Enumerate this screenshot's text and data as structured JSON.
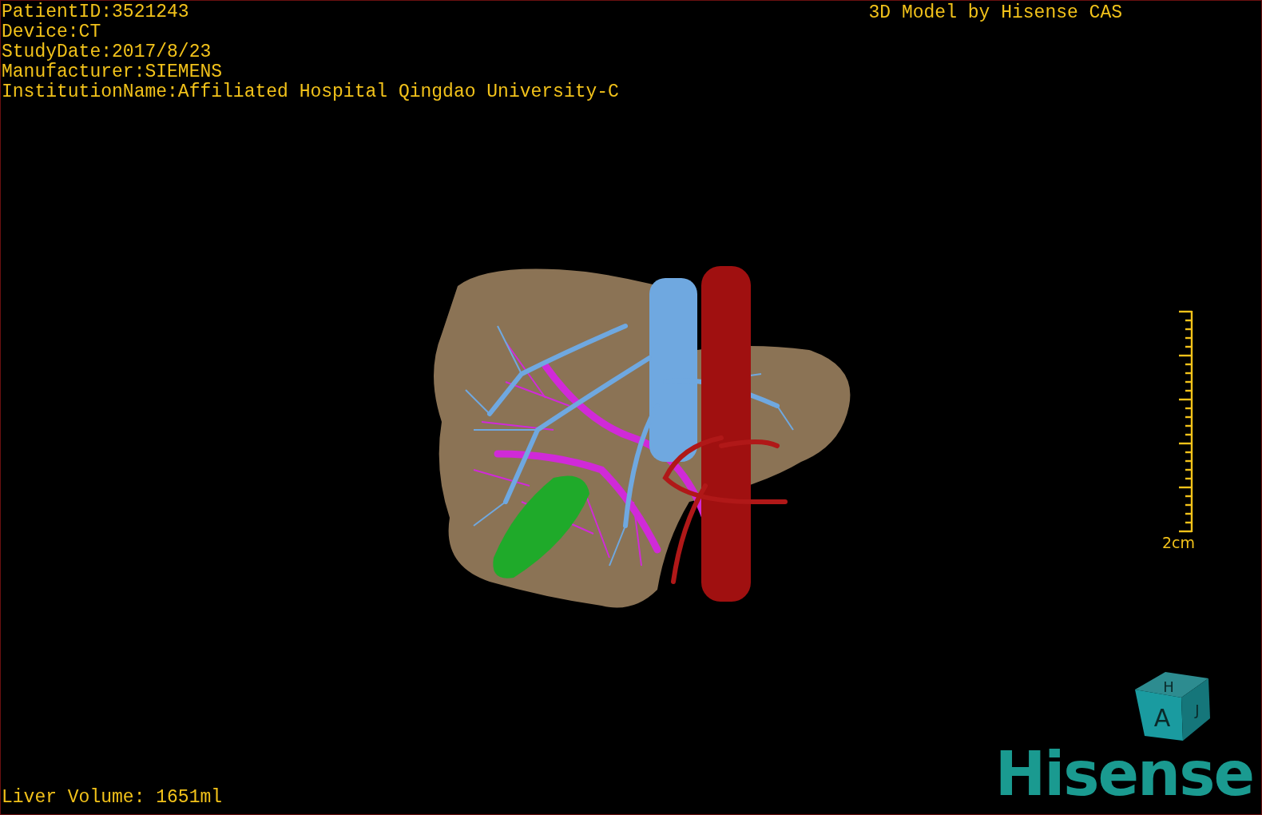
{
  "study_info": [
    "PatientID:3521243",
    "Device:CT",
    "StudyDate:2017/8/23",
    "Manufacturer:SIEMENS",
    "InstitutionName:Affiliated Hospital Qingdao University-C"
  ],
  "title": "3D Model by Hisense CAS",
  "scale_bar": {
    "label": "2cm"
  },
  "orientation_cube": {
    "top": "H",
    "front": "A",
    "side": "J"
  },
  "liver_volume": "Liver Volume: 1651ml",
  "logo": "Hisense"
}
